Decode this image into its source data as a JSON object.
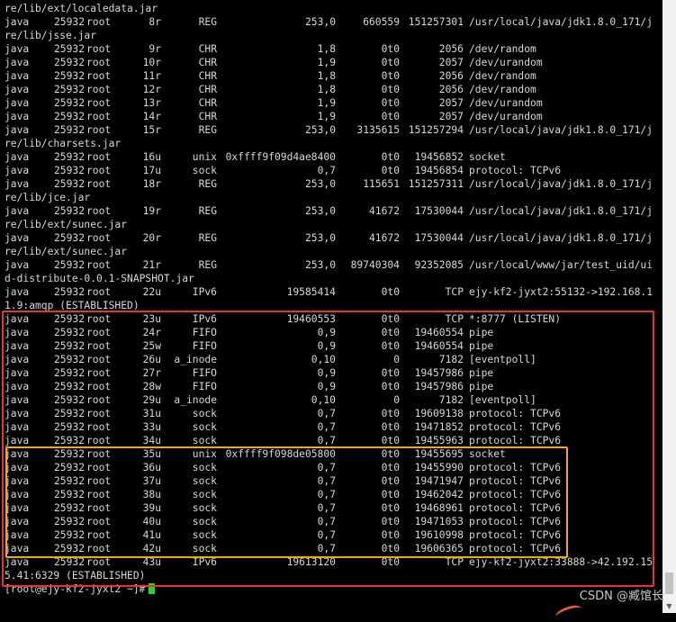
{
  "terminal": {
    "prompt": "[root@ejy-kf2-jyxt2 ~]#",
    "colors": {
      "background": "#000000",
      "text": "#d8d8d8",
      "highlight_red": "#e8342a",
      "highlight_orange": "#f2a81d",
      "cursor": "#27d427"
    },
    "lines": [
      {
        "kind": "text",
        "text": "re/lib/ext/localedata.jar"
      },
      {
        "kind": "row",
        "cols": [
          "java",
          "25932",
          "root",
          "8r",
          "REG",
          "253,0",
          "660559",
          "151257301",
          "/usr/local/java/jdk1.8.0_171/j"
        ]
      },
      {
        "kind": "text",
        "text": "re/lib/jsse.jar"
      },
      {
        "kind": "row",
        "cols": [
          "java",
          "25932",
          "root",
          "9r",
          "CHR",
          "1,8",
          "0t0",
          "2056",
          "/dev/random"
        ]
      },
      {
        "kind": "row",
        "cols": [
          "java",
          "25932",
          "root",
          "10r",
          "CHR",
          "1,9",
          "0t0",
          "2057",
          "/dev/urandom"
        ]
      },
      {
        "kind": "row",
        "cols": [
          "java",
          "25932",
          "root",
          "11r",
          "CHR",
          "1,8",
          "0t0",
          "2056",
          "/dev/random"
        ]
      },
      {
        "kind": "row",
        "cols": [
          "java",
          "25932",
          "root",
          "12r",
          "CHR",
          "1,8",
          "0t0",
          "2056",
          "/dev/random"
        ]
      },
      {
        "kind": "row",
        "cols": [
          "java",
          "25932",
          "root",
          "13r",
          "CHR",
          "1,9",
          "0t0",
          "2057",
          "/dev/urandom"
        ]
      },
      {
        "kind": "row",
        "cols": [
          "java",
          "25932",
          "root",
          "14r",
          "CHR",
          "1,9",
          "0t0",
          "2057",
          "/dev/urandom"
        ]
      },
      {
        "kind": "row",
        "cols": [
          "java",
          "25932",
          "root",
          "15r",
          "REG",
          "253,0",
          "3135615",
          "151257294",
          "/usr/local/java/jdk1.8.0_171/j"
        ]
      },
      {
        "kind": "text",
        "text": "re/lib/charsets.jar"
      },
      {
        "kind": "row",
        "cols": [
          "java",
          "25932",
          "root",
          "16u",
          "unix",
          "0xffff9f09d4ae8400",
          "0t0",
          "19456852",
          "socket"
        ]
      },
      {
        "kind": "row",
        "cols": [
          "java",
          "25932",
          "root",
          "17u",
          "sock",
          "0,7",
          "0t0",
          "19456854",
          "protocol: TCPv6"
        ]
      },
      {
        "kind": "row",
        "cols": [
          "java",
          "25932",
          "root",
          "18r",
          "REG",
          "253,0",
          "115651",
          "151257311",
          "/usr/local/java/jdk1.8.0_171/j"
        ]
      },
      {
        "kind": "text",
        "text": "re/lib/jce.jar"
      },
      {
        "kind": "row",
        "cols": [
          "java",
          "25932",
          "root",
          "19r",
          "REG",
          "253,0",
          "41672",
          "17530044",
          "/usr/local/java/jdk1.8.0_171/j"
        ]
      },
      {
        "kind": "text",
        "text": "re/lib/ext/sunec.jar"
      },
      {
        "kind": "row",
        "cols": [
          "java",
          "25932",
          "root",
          "20r",
          "REG",
          "253,0",
          "41672",
          "17530044",
          "/usr/local/java/jdk1.8.0_171/j"
        ]
      },
      {
        "kind": "text",
        "text": "re/lib/ext/sunec.jar"
      },
      {
        "kind": "row",
        "cols": [
          "java",
          "25932",
          "root",
          "21r",
          "REG",
          "253,0",
          "89740304",
          "92352085",
          "/usr/local/www/jar/test_uid/ui"
        ]
      },
      {
        "kind": "text",
        "text": "d-distribute-0.0.1-SNAPSHOT.jar"
      },
      {
        "kind": "row",
        "cols": [
          "java",
          "25932",
          "root",
          "22u",
          "IPv6",
          "19585414",
          "0t0",
          "TCP",
          "ejy-kf2-jyxt2:55132->192.168.1"
        ]
      },
      {
        "kind": "text",
        "text": "1.9:amqp (ESTABLISHED)"
      },
      {
        "kind": "row",
        "cols": [
          "java",
          "25932",
          "root",
          "23u",
          "IPv6",
          "19460553",
          "0t0",
          "TCP",
          "*:8777 (LISTEN)"
        ]
      },
      {
        "kind": "row",
        "cols": [
          "java",
          "25932",
          "root",
          "24r",
          "FIFO",
          "0,9",
          "0t0",
          "19460554",
          "pipe"
        ]
      },
      {
        "kind": "row",
        "cols": [
          "java",
          "25932",
          "root",
          "25w",
          "FIFO",
          "0,9",
          "0t0",
          "19460554",
          "pipe"
        ]
      },
      {
        "kind": "row",
        "cols": [
          "java",
          "25932",
          "root",
          "26u",
          "a_inode",
          "0,10",
          "0",
          "7182",
          "[eventpoll]"
        ]
      },
      {
        "kind": "row",
        "cols": [
          "java",
          "25932",
          "root",
          "27r",
          "FIFO",
          "0,9",
          "0t0",
          "19457986",
          "pipe"
        ]
      },
      {
        "kind": "row",
        "cols": [
          "java",
          "25932",
          "root",
          "28w",
          "FIFO",
          "0,9",
          "0t0",
          "19457986",
          "pipe"
        ]
      },
      {
        "kind": "row",
        "cols": [
          "java",
          "25932",
          "root",
          "29u",
          "a_inode",
          "0,10",
          "0",
          "7182",
          "[eventpoll]"
        ]
      },
      {
        "kind": "row",
        "cols": [
          "java",
          "25932",
          "root",
          "31u",
          "sock",
          "0,7",
          "0t0",
          "19609138",
          "protocol: TCPv6"
        ]
      },
      {
        "kind": "row",
        "cols": [
          "java",
          "25932",
          "root",
          "33u",
          "sock",
          "0,7",
          "0t0",
          "19471852",
          "protocol: TCPv6"
        ]
      },
      {
        "kind": "row",
        "cols": [
          "java",
          "25932",
          "root",
          "34u",
          "sock",
          "0,7",
          "0t0",
          "19455963",
          "protocol: TCPv6"
        ]
      },
      {
        "kind": "row",
        "cols": [
          "java",
          "25932",
          "root",
          "35u",
          "unix",
          "0xffff9f098de05800",
          "0t0",
          "19455695",
          "socket"
        ]
      },
      {
        "kind": "row",
        "cols": [
          "java",
          "25932",
          "root",
          "36u",
          "sock",
          "0,7",
          "0t0",
          "19455990",
          "protocol: TCPv6"
        ]
      },
      {
        "kind": "row",
        "cols": [
          "java",
          "25932",
          "root",
          "37u",
          "sock",
          "0,7",
          "0t0",
          "19471947",
          "protocol: TCPv6"
        ]
      },
      {
        "kind": "row",
        "cols": [
          "java",
          "25932",
          "root",
          "38u",
          "sock",
          "0,7",
          "0t0",
          "19462042",
          "protocol: TCPv6"
        ]
      },
      {
        "kind": "row",
        "cols": [
          "java",
          "25932",
          "root",
          "39u",
          "sock",
          "0,7",
          "0t0",
          "19468961",
          "protocol: TCPv6"
        ]
      },
      {
        "kind": "row",
        "cols": [
          "java",
          "25932",
          "root",
          "40u",
          "sock",
          "0,7",
          "0t0",
          "19471053",
          "protocol: TCPv6"
        ]
      },
      {
        "kind": "row",
        "cols": [
          "java",
          "25932",
          "root",
          "41u",
          "sock",
          "0,7",
          "0t0",
          "19610998",
          "protocol: TCPv6"
        ]
      },
      {
        "kind": "row",
        "cols": [
          "java",
          "25932",
          "root",
          "42u",
          "sock",
          "0,7",
          "0t0",
          "19606365",
          "protocol: TCPv6"
        ]
      },
      {
        "kind": "row",
        "cols": [
          "java",
          "25932",
          "root",
          "43u",
          "IPv6",
          "19613120",
          "0t0",
          "TCP",
          "ejy-kf2-jyxt2:33888->42.192.15"
        ]
      },
      {
        "kind": "text",
        "text": "5.41:6329 (ESTABLISHED)"
      }
    ]
  },
  "watermark": "CSDN @臧馆长",
  "scrollbar": {
    "down_arrow": "▼"
  }
}
